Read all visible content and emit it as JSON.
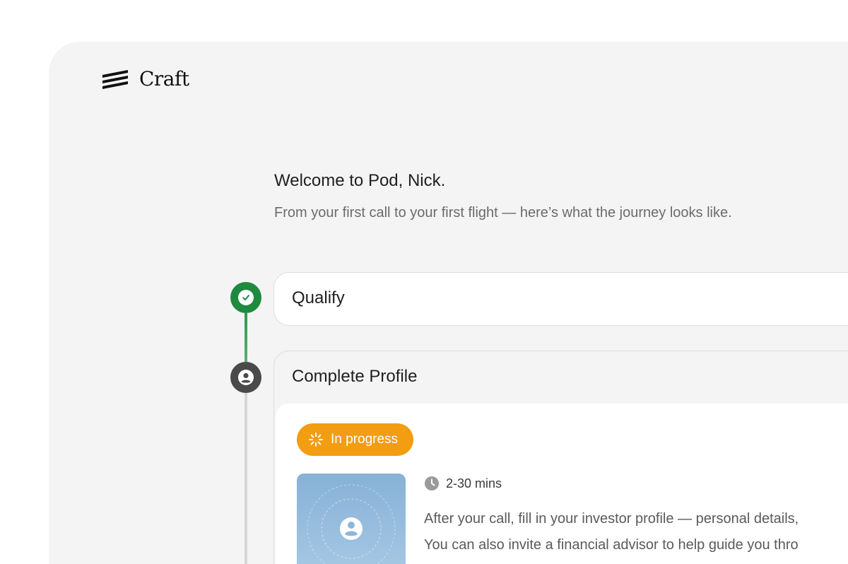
{
  "brand": {
    "name": "Craft",
    "logo_icon": "craft-stripes-logo"
  },
  "welcome": {
    "title": "Welcome to Pod, Nick.",
    "subtitle": "From your first call to your first flight — here’s what the journey looks like."
  },
  "timeline": {
    "steps": [
      {
        "label": "Qualify",
        "status": "completed",
        "icon": "check-icon"
      },
      {
        "label": "Complete Profile",
        "status": "current",
        "icon": "user-icon",
        "badge": "In progress",
        "badge_icon": "spinner-icon",
        "duration": "2-30 mins",
        "duration_icon": "clock-icon",
        "description_lines": [
          "After your call, fill in your investor profile — personal details,",
          "You can also invite a financial advisor to help guide you thro"
        ]
      }
    ]
  },
  "colors": {
    "panel_bg": "#f4f4f4",
    "completed": "#1f8a3f",
    "current": "#4a4a4a",
    "badge": "#f29d12"
  }
}
